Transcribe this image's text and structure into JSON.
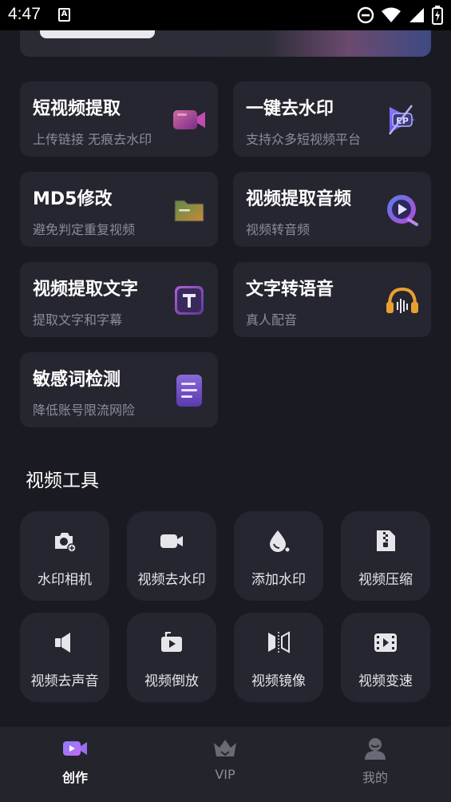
{
  "status_bar": {
    "time": "4:47",
    "notification_letter": "A"
  },
  "tools": [
    {
      "title": "短视频提取",
      "subtitle": "上传链接 无痕去水印",
      "icon": "video-camera-icon"
    },
    {
      "title": "一键去水印",
      "subtitle": "支持众多短视频平台",
      "icon": "watermark-stamp-icon"
    },
    {
      "title": "MD5修改",
      "subtitle": "避免判定重复视频",
      "icon": "folder-icon"
    },
    {
      "title": "视频提取音频",
      "subtitle": "视频转音频",
      "icon": "audio-play-icon"
    },
    {
      "title": "视频提取文字",
      "subtitle": "提取文字和字幕",
      "icon": "text-t-icon"
    },
    {
      "title": "文字转语音",
      "subtitle": "真人配音",
      "icon": "headphones-icon"
    },
    {
      "title": "敏感词检测",
      "subtitle": "降低账号限流网险",
      "icon": "document-lines-icon"
    }
  ],
  "video_tools": {
    "title": "视频工具",
    "items": [
      {
        "label": "水印相机",
        "icon": "camera-plus-icon"
      },
      {
        "label": "视频去水印",
        "icon": "video-icon"
      },
      {
        "label": "添加水印",
        "icon": "water-drop-icon"
      },
      {
        "label": "视频压缩",
        "icon": "zip-file-icon"
      },
      {
        "label": "视频去声音",
        "icon": "speaker-mute-icon"
      },
      {
        "label": "视频倒放",
        "icon": "replay-screen-icon"
      },
      {
        "label": "视频镜像",
        "icon": "mirror-icon"
      },
      {
        "label": "视频变速",
        "icon": "film-speed-icon"
      }
    ]
  },
  "bottom_nav": [
    {
      "label": "创作",
      "icon": "create-video-icon",
      "active": true
    },
    {
      "label": "VIP",
      "icon": "crown-icon",
      "active": false
    },
    {
      "label": "我的",
      "icon": "profile-icon",
      "active": false
    }
  ],
  "colors": {
    "background": "#1a1a22",
    "card": "#262630",
    "accent": "#6a5cff",
    "muted_text": "#8c8c98"
  }
}
